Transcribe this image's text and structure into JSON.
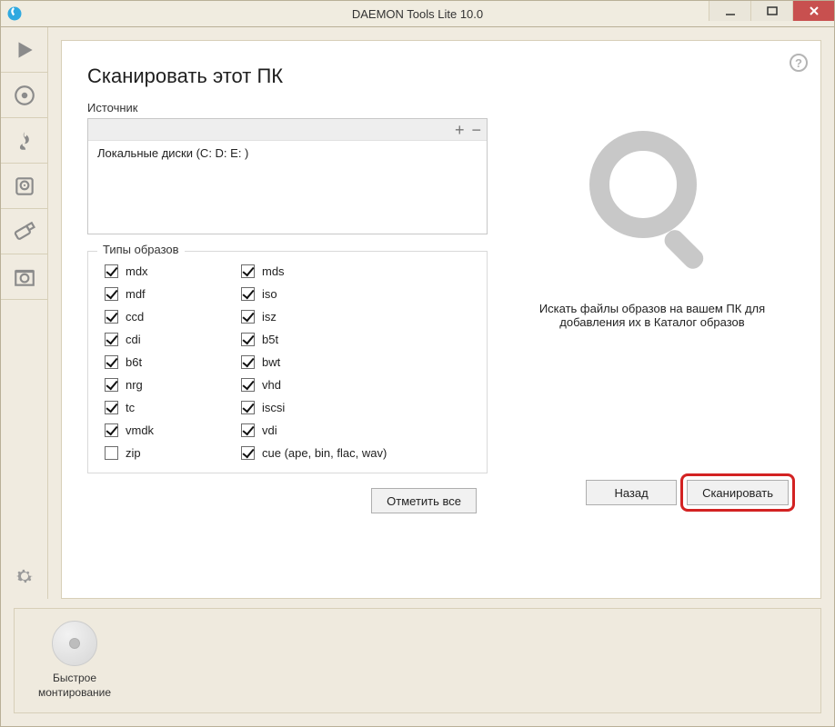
{
  "window": {
    "title": "DAEMON Tools Lite 10.0"
  },
  "page": {
    "title": "Сканировать этот ПК",
    "source_label": "Источник",
    "source_entry": "Локальные диски (C: D: E: )",
    "types_legend": "Типы образов",
    "select_all_label": "Отметить все",
    "hint": "Искать файлы образов на вашем ПК для добавления их в Каталог образов",
    "back_label": "Назад",
    "scan_label": "Сканировать"
  },
  "types_col1": [
    {
      "label": "mdx",
      "checked": true
    },
    {
      "label": "mdf",
      "checked": true
    },
    {
      "label": "ccd",
      "checked": true
    },
    {
      "label": "cdi",
      "checked": true
    },
    {
      "label": "b6t",
      "checked": true
    },
    {
      "label": "nrg",
      "checked": true
    },
    {
      "label": "tc",
      "checked": true
    },
    {
      "label": "vmdk",
      "checked": true
    },
    {
      "label": "zip",
      "checked": false
    }
  ],
  "types_col2": [
    {
      "label": "mds",
      "checked": true
    },
    {
      "label": "iso",
      "checked": true
    },
    {
      "label": "isz",
      "checked": true
    },
    {
      "label": "b5t",
      "checked": true
    },
    {
      "label": "bwt",
      "checked": true
    },
    {
      "label": "vhd",
      "checked": true
    },
    {
      "label": "iscsi",
      "checked": true
    },
    {
      "label": "vdi",
      "checked": true
    },
    {
      "label": "cue (ape, bin, flac, wav)",
      "checked": true
    }
  ],
  "footer": {
    "quick_mount_label": "Быстрое монтирование"
  }
}
